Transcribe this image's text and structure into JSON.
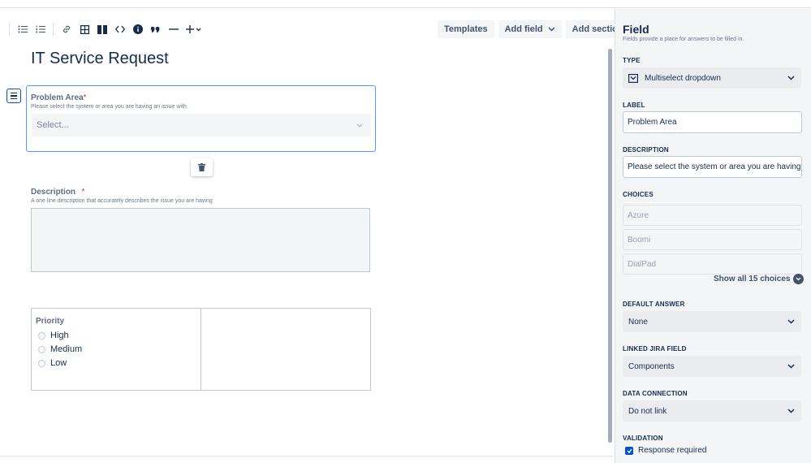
{
  "toolbar": {
    "icons": [
      "bulleted-list-icon",
      "numbered-list-icon",
      "link-icon",
      "table-icon",
      "layout-icon",
      "code-icon",
      "info-icon",
      "quote-icon",
      "divider-icon",
      "insert-plus-icon"
    ],
    "templates_label": "Templates",
    "add_field_label": "Add field",
    "add_section_label": "Add section"
  },
  "form": {
    "title": "IT Service Request",
    "problem_area": {
      "label": "Problem Area",
      "required_mark": "*",
      "help": "Please select the system or area you are having an issue with",
      "placeholder": "Select..."
    },
    "description": {
      "label": "Description",
      "required_mark": "*",
      "help": "A one line description that accurately describes the issue you are having"
    },
    "priority": {
      "label": "Priority",
      "options": [
        "High",
        "Medium",
        "Low"
      ]
    }
  },
  "panel": {
    "title": "Field",
    "subtitle": "Fields provide a place for answers to be filled in.",
    "type_caption": "TYPE",
    "type_value": "Multiselect dropdown",
    "label_caption": "LABEL",
    "label_value": "Problem Area",
    "description_caption": "DESCRIPTION",
    "description_value": "Please select the system or area you are having an issue with",
    "choices_caption": "CHOICES",
    "choices": [
      "Azure",
      "Boomi",
      "DialPad"
    ],
    "show_all": "Show all 15 choices",
    "default_caption": "DEFAULT ANSWER",
    "default_value": "None",
    "linked_caption": "LINKED JIRA FIELD",
    "linked_value": "Components",
    "data_caption": "DATA CONNECTION",
    "data_value": "Do not link",
    "validation_caption": "VALIDATION",
    "response_required": "Response required"
  },
  "colors": {
    "accent": "#0052cc",
    "selected_border": "#4c9aff",
    "required": "#de350b",
    "panel_bg": "#f4f5f7"
  }
}
